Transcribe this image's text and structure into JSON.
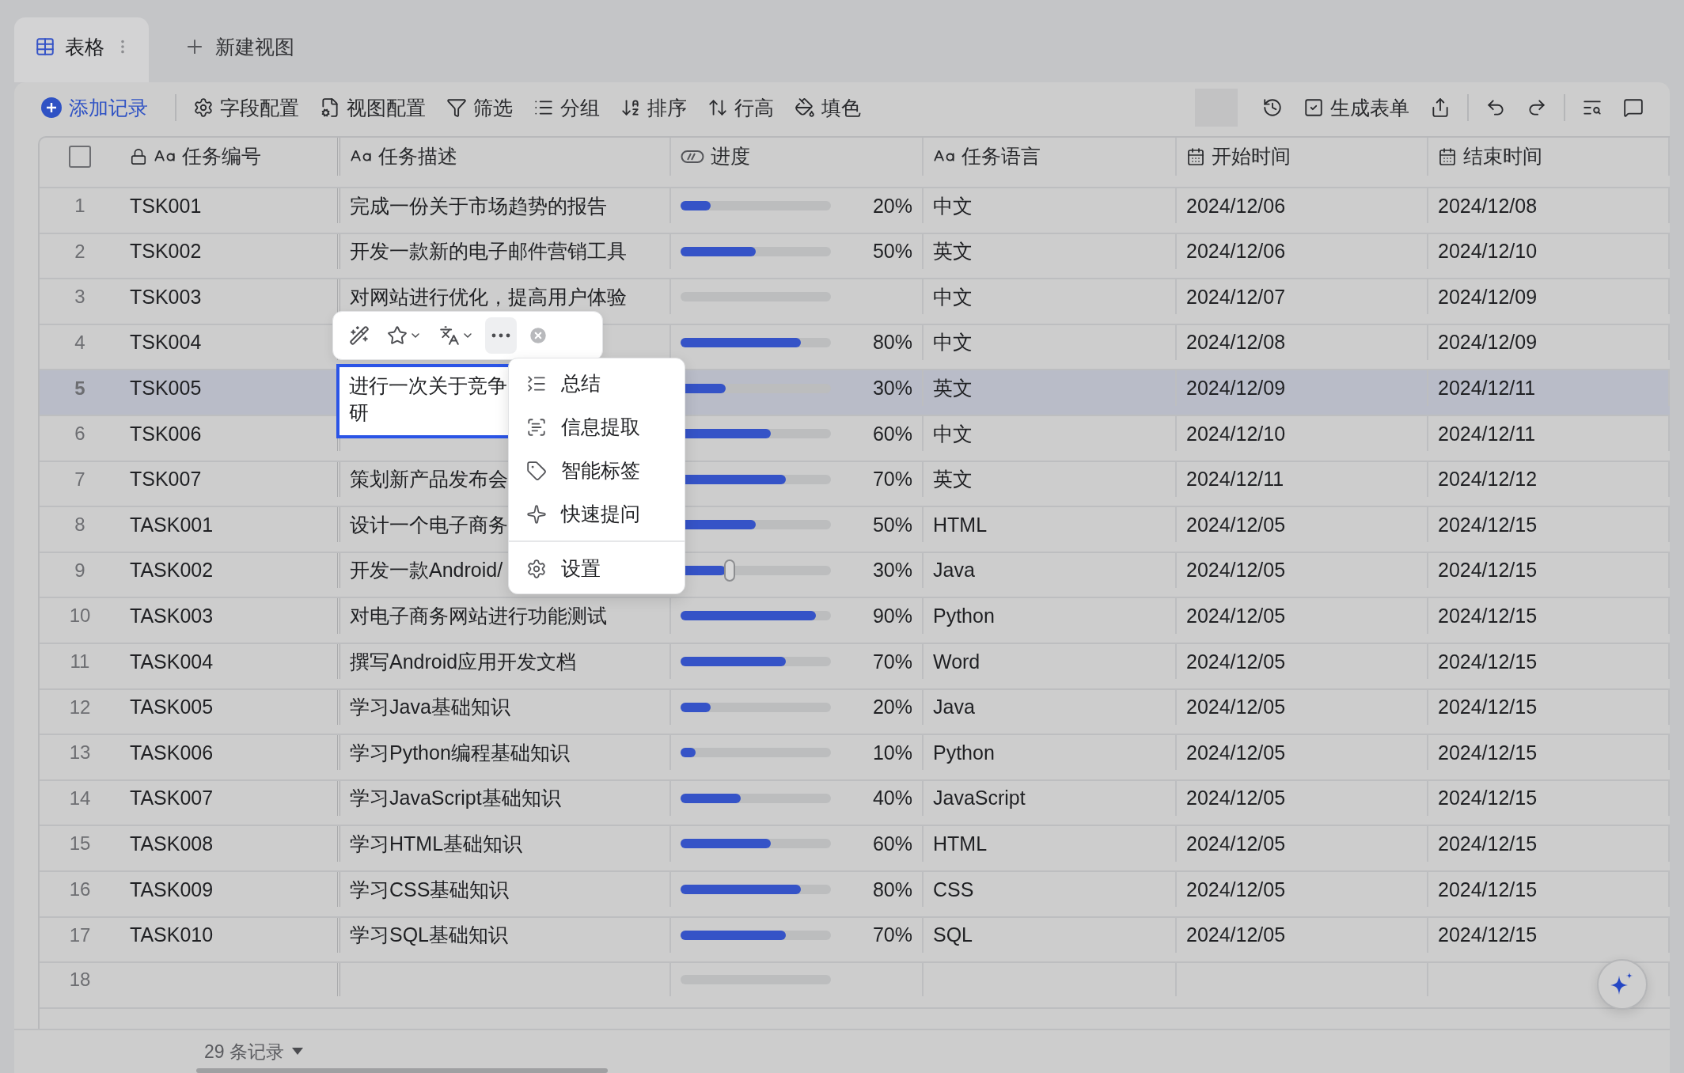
{
  "view_tabs": [
    {
      "kind": "view",
      "label": "表格",
      "selected": true
    },
    {
      "kind": "add",
      "label": "新建视图",
      "selected": false
    }
  ],
  "toolbar": {
    "add_record": "添加记录",
    "left": [
      {
        "kind": "fields",
        "label": "字段配置"
      },
      {
        "kind": "view",
        "label": "视图配置"
      },
      {
        "kind": "filter",
        "label": "筛选"
      },
      {
        "kind": "group",
        "label": "分组"
      },
      {
        "kind": "sort",
        "label": "排序"
      },
      {
        "kind": "height",
        "label": "行高"
      },
      {
        "kind": "fill",
        "label": "填色"
      }
    ],
    "right": [
      {
        "kind": "history"
      },
      {
        "kind": "form",
        "label": "生成表单"
      },
      {
        "kind": "share"
      },
      {
        "kind": "undo"
      },
      {
        "kind": "redo"
      },
      {
        "kind": "search"
      },
      {
        "kind": "comment"
      }
    ]
  },
  "table": {
    "select_all": {
      "checked": false
    },
    "columns": [
      {
        "kind": "text",
        "label": "任务编号",
        "locked": true
      },
      {
        "kind": "text",
        "label": "任务描述",
        "locked": false
      },
      {
        "kind": "progress",
        "label": "进度",
        "locked": false
      },
      {
        "kind": "text",
        "label": "任务语言",
        "locked": false
      },
      {
        "kind": "date",
        "label": "开始时间",
        "locked": false
      },
      {
        "kind": "date",
        "label": "结束时间",
        "locked": false
      }
    ],
    "rows": [
      {
        "number": "1",
        "id": "TSK001",
        "description": "完成一份关于市场趋势的报告",
        "progress": {
          "level": 0.2,
          "reading": "20%"
        },
        "language": "中文",
        "start": "2024/12/06",
        "end": "2024/12/08",
        "selected": false
      },
      {
        "number": "2",
        "id": "TSK002",
        "description": "开发一款新的电子邮件营销工具",
        "progress": {
          "level": 0.5,
          "reading": "50%"
        },
        "language": "英文",
        "start": "2024/12/06",
        "end": "2024/12/10",
        "selected": false
      },
      {
        "number": "3",
        "id": "TSK003",
        "description": "对网站进行优化，提高用户体验",
        "progress": {
          "level": 0
        },
        "language": "中文",
        "start": "2024/12/07",
        "end": "2024/12/09",
        "selected": false
      },
      {
        "number": "4",
        "id": "TSK004",
        "progress": {
          "level": 0.8,
          "reading": "80%"
        },
        "language": "中文",
        "start": "2024/12/08",
        "end": "2024/12/09",
        "selected": false
      },
      {
        "number": "5",
        "id": "TSK005",
        "progress": {
          "level": 0.3,
          "reading": "30%"
        },
        "language": "英文",
        "start": "2024/12/09",
        "end": "2024/12/11",
        "selected": true
      },
      {
        "number": "6",
        "id": "TSK006",
        "progress": {
          "level": 0.6,
          "reading": "60%"
        },
        "language": "中文",
        "start": "2024/12/10",
        "end": "2024/12/11",
        "selected": false
      },
      {
        "number": "7",
        "id": "TSK007",
        "description": "策划新产品发布会",
        "progress": {
          "level": 0.7,
          "reading": "70%"
        },
        "language": "英文",
        "start": "2024/12/11",
        "end": "2024/12/12",
        "selected": false
      },
      {
        "number": "8",
        "id": "TASK001",
        "description": "设计一个电子商务",
        "progress": {
          "level": 0.5,
          "reading": "50%"
        },
        "language": "HTML",
        "start": "2024/12/05",
        "end": "2024/12/15",
        "selected": false
      },
      {
        "number": "9",
        "id": "TASK002",
        "description": "开发一款Android/",
        "progress": {
          "level": 0.3,
          "reading": "30%",
          "thumb": true
        },
        "language": "Java",
        "start": "2024/12/05",
        "end": "2024/12/15",
        "selected": false
      },
      {
        "number": "10",
        "id": "TASK003",
        "description": "对电子商务网站进行功能测试",
        "progress": {
          "level": 0.9,
          "reading": "90%"
        },
        "language": "Python",
        "start": "2024/12/05",
        "end": "2024/12/15",
        "selected": false
      },
      {
        "number": "11",
        "id": "TASK004",
        "description": "撰写Android应用开发文档",
        "progress": {
          "level": 0.7,
          "reading": "70%"
        },
        "language": "Word",
        "start": "2024/12/05",
        "end": "2024/12/15",
        "selected": false
      },
      {
        "number": "12",
        "id": "TASK005",
        "description": "学习Java基础知识",
        "progress": {
          "level": 0.2,
          "reading": "20%"
        },
        "language": "Java",
        "start": "2024/12/05",
        "end": "2024/12/15",
        "selected": false
      },
      {
        "number": "13",
        "id": "TASK006",
        "description": "学习Python编程基础知识",
        "progress": {
          "level": 0.1,
          "reading": "10%"
        },
        "language": "Python",
        "start": "2024/12/05",
        "end": "2024/12/15",
        "selected": false
      },
      {
        "number": "14",
        "id": "TASK007",
        "description": "学习JavaScript基础知识",
        "progress": {
          "level": 0.4,
          "reading": "40%"
        },
        "language": "JavaScript",
        "start": "2024/12/05",
        "end": "2024/12/15",
        "selected": false
      },
      {
        "number": "15",
        "id": "TASK008",
        "description": "学习HTML基础知识",
        "progress": {
          "level": 0.6,
          "reading": "60%"
        },
        "language": "HTML",
        "start": "2024/12/05",
        "end": "2024/12/15",
        "selected": false
      },
      {
        "number": "16",
        "id": "TASK009",
        "description": "学习CSS基础知识",
        "progress": {
          "level": 0.8,
          "reading": "80%"
        },
        "language": "CSS",
        "start": "2024/12/05",
        "end": "2024/12/15",
        "selected": false
      },
      {
        "number": "17",
        "id": "TASK010",
        "description": "学习SQL基础知识",
        "progress": {
          "level": 0.7,
          "reading": "70%"
        },
        "language": "SQL",
        "start": "2024/12/05",
        "end": "2024/12/15",
        "selected": false
      },
      {
        "number": "18",
        "progress": {
          "level": 0
        },
        "selected": false
      }
    ]
  },
  "footer": {
    "record_count": "29 条记录"
  },
  "cell_editor": {
    "lines": [
      "进行一次关于竞争",
      "研"
    ]
  },
  "ai_toolbar": [
    {
      "kind": "wand",
      "selected": false
    },
    {
      "kind": "star",
      "dropdown": true,
      "selected": false
    },
    {
      "kind": "translate",
      "dropdown": true,
      "selected": false
    },
    {
      "kind": "more",
      "selected": true
    },
    {
      "kind": "close",
      "selected": false
    }
  ],
  "ai_menu": {
    "items": [
      {
        "kind": "summary",
        "label": "总结"
      },
      {
        "kind": "extract",
        "label": "信息提取"
      },
      {
        "kind": "tag",
        "label": "智能标签"
      },
      {
        "kind": "ask",
        "label": "快速提问"
      }
    ],
    "footer": [
      {
        "kind": "settings",
        "label": "设置"
      }
    ]
  }
}
